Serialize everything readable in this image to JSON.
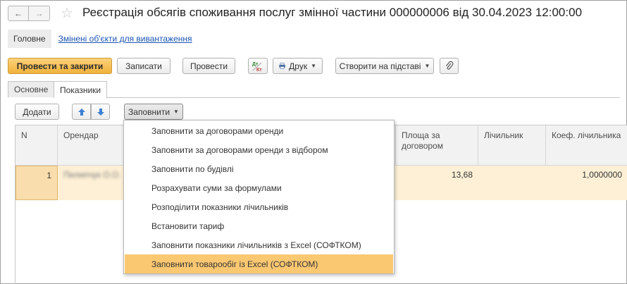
{
  "window": {
    "title": "Реєстрація обсягів споживання послуг змінної частини 000000006 від 30.04.2023 12:00:00"
  },
  "nav": {
    "back": "←",
    "forward": "→",
    "favorite": "☆"
  },
  "sections": {
    "main": "Головне",
    "link": "Змінені об'єкти для вивантаження"
  },
  "toolbar": {
    "post_close": "Провести та закрити",
    "save": "Записати",
    "post": "Провести",
    "dt_kt": "Дт Кт",
    "print": "Друк",
    "create_based": "Створити на підставі"
  },
  "tabs": [
    {
      "label": "Основне"
    },
    {
      "label": "Показники"
    }
  ],
  "table_toolbar": {
    "add": "Додати",
    "fill": "Заповнити"
  },
  "table": {
    "columns": [
      "N",
      "Орендар",
      "Площа за договором",
      "Лічильник",
      "Коеф. лічильника"
    ],
    "rows": [
      {
        "n": "1",
        "tenant": "Пилипчук О.О.",
        "area": "13,68",
        "counter": "",
        "coef": "1,0000000"
      }
    ]
  },
  "fill_menu": {
    "items": [
      "Заповнити за договорами оренди",
      "Заповнити за договорами оренди з відбором",
      "Заповнити по будівлі",
      "Розрахувати суми за формулами",
      "Розподілити показники лічильників",
      "Встановити тариф",
      "Заповнити показники лічильників з Excel (СОФТКОМ)",
      "Заповнити товарообіг із Excel (СОФТКОМ)"
    ],
    "highlighted_index": 7
  },
  "colors": {
    "accent": "#f1b23b",
    "highlight": "#fbc872",
    "row_bg": "#fdf0d6",
    "link": "#1a55b3"
  }
}
